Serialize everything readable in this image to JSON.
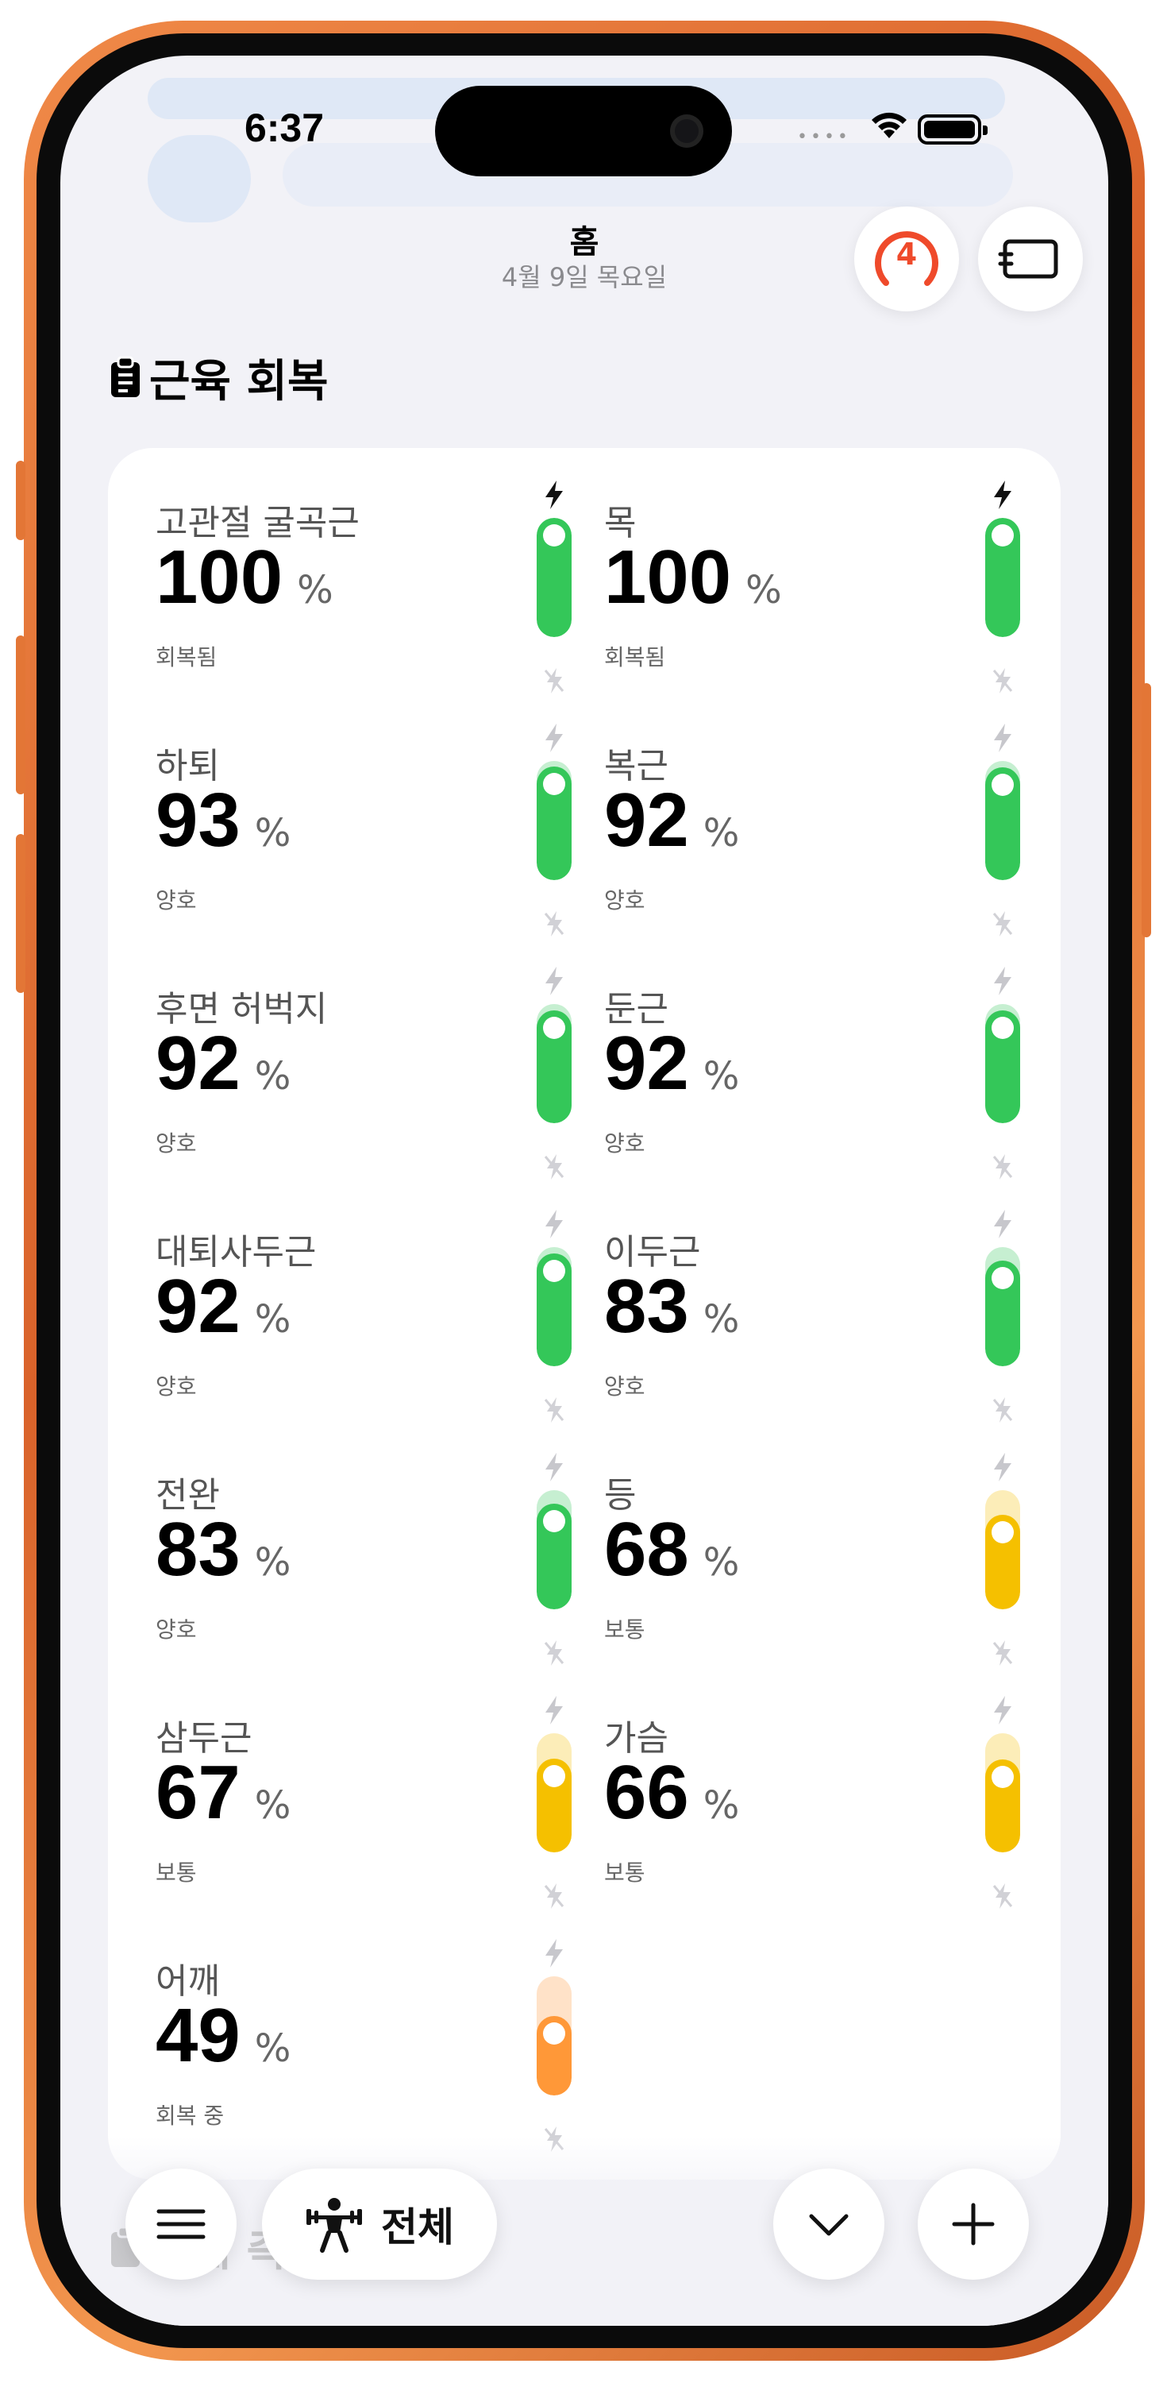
{
  "status_bar": {
    "time": "6:37"
  },
  "header": {
    "title": "홈",
    "date": "4월 9일 목요일",
    "badge_count": "4",
    "badge_color": "#ef4a2b"
  },
  "section": {
    "title": "근육 회복",
    "icon": "clipboard-icon"
  },
  "muscles": [
    {
      "name": "고관절 굴곡근",
      "value": 100,
      "unit": "%",
      "status": "회복됨",
      "color": "#34c759",
      "charging": true
    },
    {
      "name": "목",
      "value": 100,
      "unit": "%",
      "status": "회복됨",
      "color": "#34c759",
      "charging": true
    },
    {
      "name": "하퇴",
      "value": 93,
      "unit": "%",
      "status": "양호",
      "color": "#34c759",
      "charging": false
    },
    {
      "name": "복근",
      "value": 92,
      "unit": "%",
      "status": "양호",
      "color": "#34c759",
      "charging": false
    },
    {
      "name": "후면 허벅지",
      "value": 92,
      "unit": "%",
      "status": "양호",
      "color": "#34c759",
      "charging": false
    },
    {
      "name": "둔근",
      "value": 92,
      "unit": "%",
      "status": "양호",
      "color": "#34c759",
      "charging": false
    },
    {
      "name": "대퇴사두근",
      "value": 92,
      "unit": "%",
      "status": "양호",
      "color": "#34c759",
      "charging": false
    },
    {
      "name": "이두근",
      "value": 83,
      "unit": "%",
      "status": "양호",
      "color": "#34c759",
      "charging": false
    },
    {
      "name": "전완",
      "value": 83,
      "unit": "%",
      "status": "양호",
      "color": "#34c759",
      "charging": false
    },
    {
      "name": "등",
      "value": 68,
      "unit": "%",
      "status": "보통",
      "color": "#f5c000",
      "charging": false
    },
    {
      "name": "삼두근",
      "value": 67,
      "unit": "%",
      "status": "보통",
      "color": "#f5c000",
      "charging": false
    },
    {
      "name": "가슴",
      "value": 66,
      "unit": "%",
      "status": "보통",
      "color": "#f5c000",
      "charging": false
    },
    {
      "name": "어깨",
      "value": 49,
      "unit": "%",
      "status": "회복 중",
      "color": "#ff9838",
      "charging": false
    }
  ],
  "next_section": {
    "title": "신체 측정"
  },
  "toolbar": {
    "menu_icon": "hamburger-icon",
    "filter_label": "전체",
    "filter_icon": "weightlifter-icon",
    "collapse_icon": "chevron-down-icon",
    "add_icon": "plus-icon"
  }
}
